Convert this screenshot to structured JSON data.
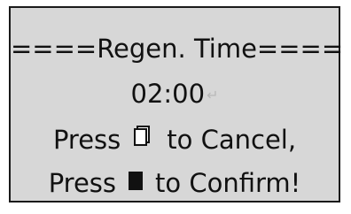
{
  "screen": {
    "title": "====Regen. Time====",
    "time": "02:00",
    "return_mark": "↵",
    "cancel": {
      "prefix": "Press",
      "suffix": "to Cancel,",
      "icon": "blank-key-icon"
    },
    "confirm": {
      "prefix": "Press",
      "suffix": "to Confirm!",
      "icon": "solid-key-icon"
    }
  }
}
